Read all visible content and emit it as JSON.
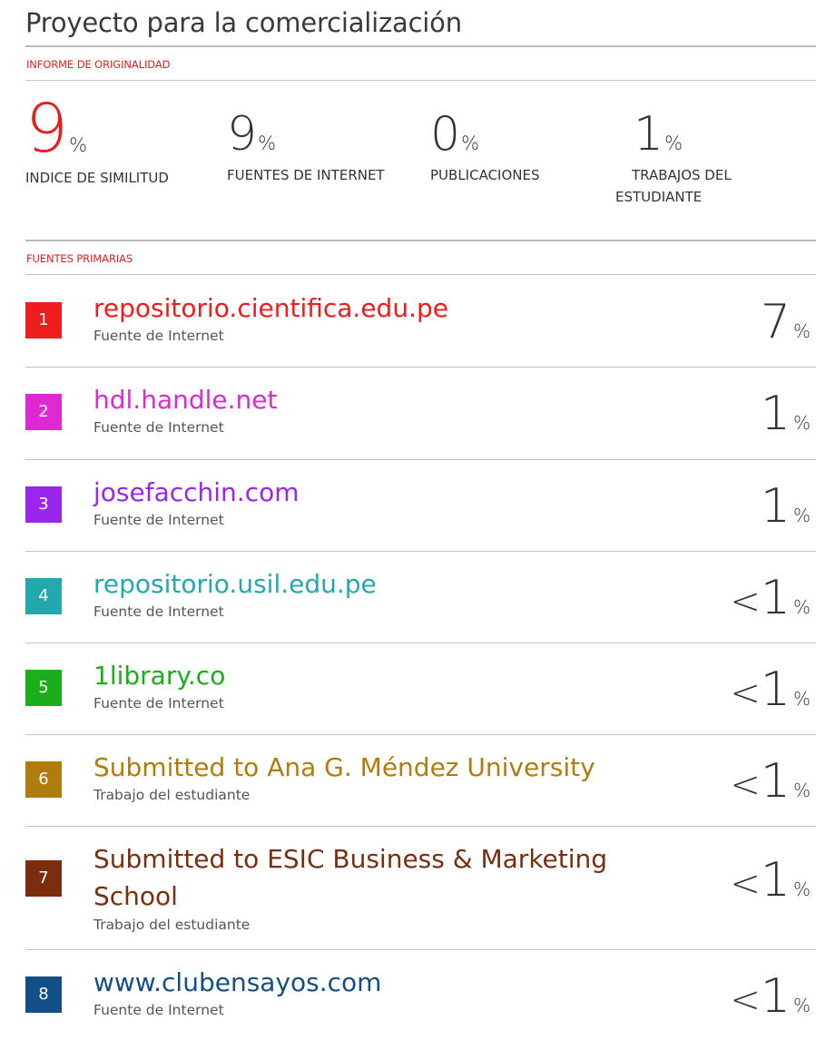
{
  "title": "Proyecto para la comercialización",
  "report_label": "INFORME DE ORIGINALIDAD",
  "stats": {
    "similarity": {
      "value": "9",
      "unit": "%",
      "label": "INDICE DE SIMILITUD"
    },
    "internet": {
      "value": "9",
      "unit": "%",
      "label": "FUENTES DE INTERNET"
    },
    "publications": {
      "value": "0",
      "unit": "%",
      "label": "PUBLICACIONES"
    },
    "student": {
      "value": "1",
      "unit": "%",
      "label_line1": "TRABAJOS DEL",
      "label_line2": "ESTUDIANTE"
    }
  },
  "primary_label": "FUENTES PRIMARIAS",
  "sources": [
    {
      "rank": "1",
      "name": "repositorio.cientifica.edu.pe",
      "type": "Fuente de Internet",
      "prefix": "",
      "value": "7",
      "unit": "%",
      "color": "#ee1c1c"
    },
    {
      "rank": "2",
      "name": "hdl.handle.net",
      "type": "Fuente de Internet",
      "prefix": "",
      "value": "1",
      "unit": "%",
      "color": "#dd28d3"
    },
    {
      "rank": "3",
      "name": "josefacchin.com",
      "type": "Fuente de Internet",
      "prefix": "",
      "value": "1",
      "unit": "%",
      "color": "#9a26ee"
    },
    {
      "rank": "4",
      "name": "repositorio.usil.edu.pe",
      "type": "Fuente de Internet",
      "prefix": "<",
      "value": "1",
      "unit": "%",
      "color": "#21a9ae"
    },
    {
      "rank": "5",
      "name": "1library.co",
      "type": "Fuente de Internet",
      "prefix": "<",
      "value": "1",
      "unit": "%",
      "color": "#1aae1a"
    },
    {
      "rank": "6",
      "name": "Submitted to Ana G. Méndez University",
      "type": "Trabajo del estudiante",
      "prefix": "<",
      "value": "1",
      "unit": "%",
      "color": "#b07d0c"
    },
    {
      "rank": "7",
      "name_line1": "Submitted to ESIC Business & Marketing",
      "name_line2": "School",
      "type": "Trabajo del estudiante",
      "prefix": "<",
      "value": "1",
      "unit": "%",
      "color": "#7a2e0d"
    },
    {
      "rank": "8",
      "name": "www.clubensayos.com",
      "type": "Fuente de Internet",
      "prefix": "<",
      "value": "1",
      "unit": "%",
      "color": "#134f86"
    }
  ]
}
